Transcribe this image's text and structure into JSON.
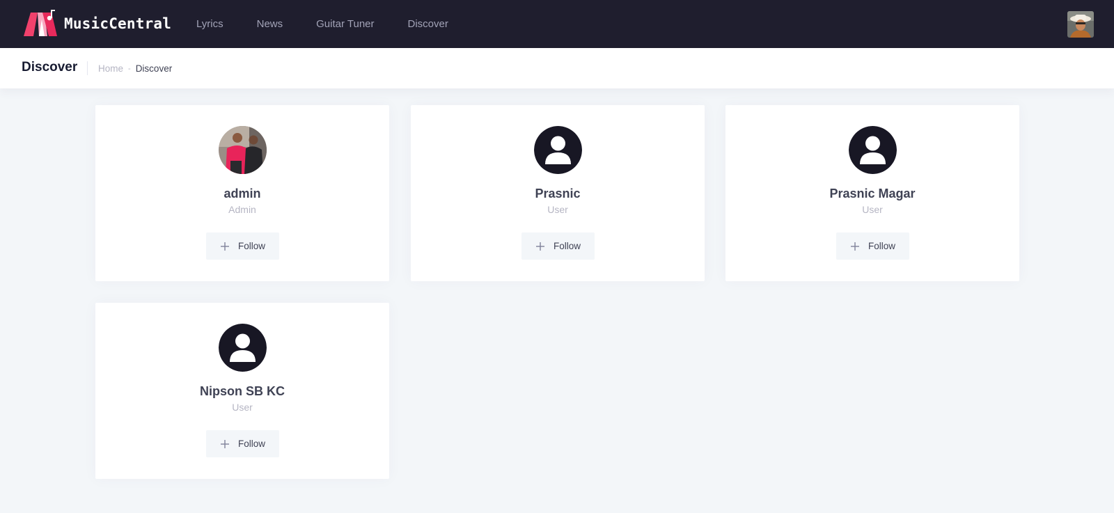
{
  "brand": {
    "name": "MusicCentral",
    "logo_icon": "music-note-logo-icon"
  },
  "nav": {
    "links": [
      {
        "label": "Lyrics"
      },
      {
        "label": "News"
      },
      {
        "label": "Guitar Tuner"
      },
      {
        "label": "Discover"
      }
    ],
    "avatar_icon": "user-avatar-photo"
  },
  "subheader": {
    "title": "Discover",
    "breadcrumb": {
      "home": "Home",
      "separator": "-",
      "current": "Discover"
    }
  },
  "cards": [
    {
      "name": "admin",
      "role": "Admin",
      "avatar": "photo",
      "follow_label": "Follow"
    },
    {
      "name": "Prasnic",
      "role": "User",
      "avatar": "default-user-icon",
      "follow_label": "Follow"
    },
    {
      "name": "Prasnic Magar",
      "role": "User",
      "avatar": "default-user-icon",
      "follow_label": "Follow"
    },
    {
      "name": "Nipson SB KC",
      "role": "User",
      "avatar": "default-user-icon",
      "follow_label": "Follow"
    }
  ],
  "colors": {
    "navbar_bg": "#1f1e2e",
    "brand_accent": "#f1416c",
    "page_bg": "#f3f6f9",
    "card_bg": "#ffffff",
    "avatar_dark": "#181724"
  }
}
